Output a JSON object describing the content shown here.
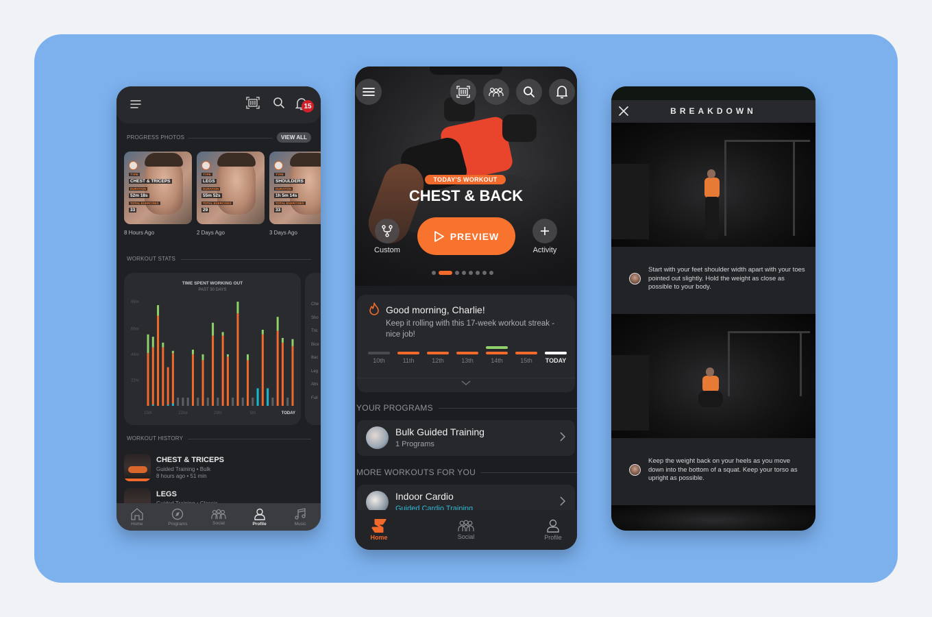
{
  "colors": {
    "page_bg": "#f1f2f6",
    "stage_bg": "#7cb1ee",
    "accent_orange": "#f26a2b",
    "accent_green": "#8fd16a",
    "accent_cyan": "#1bb8d0",
    "rest_gray": "#5e6064",
    "badge_red": "#d0202a"
  },
  "profile_screen": {
    "header": {
      "menu_icon": "hamburger-icon",
      "scan_icon": "barcode-scan-icon",
      "search_icon": "search-icon",
      "bell_icon": "bell-icon",
      "notification_count": "15"
    },
    "progress_photos": {
      "title": "PROGRESS PHOTOS",
      "view_all": "VIEW ALL",
      "photos": [
        {
          "type_label": "TYPE",
          "type": "CHEST & TRICEPS",
          "duration_label": "DURATION",
          "duration": "52m 18s",
          "exercises_label": "TOTAL EXERCISES",
          "exercises": "33",
          "caption": "8 Hours Ago"
        },
        {
          "type_label": "TYPE",
          "type": "LEGS",
          "duration_label": "DURATION",
          "duration": "55m 52s",
          "exercises_label": "TOTAL EXERCISES",
          "exercises": "29",
          "caption": "2 Days Ago"
        },
        {
          "type_label": "TYPE",
          "type": "SHOULDERS",
          "duration_label": "DURATION",
          "duration": "1h 5m 14s",
          "exercises_label": "TOTAL EXERCISES",
          "exercises": "33",
          "caption": "3 Days Ago"
        }
      ]
    },
    "workout_stats": {
      "title": "WORKOUT STATS",
      "muscle_labels": [
        "Che",
        "Sho",
        "Tric",
        "Bice",
        "Bac",
        "Leg",
        "Abs",
        "Full"
      ]
    },
    "workout_history": {
      "title": "WORKOUT HISTORY",
      "items": [
        {
          "title": "CHEST & TRICEPS",
          "line1": "Guided Training • Bulk",
          "line2": "8 hours ago • 51 min"
        },
        {
          "title": "LEGS",
          "line1": "Guided Training • Classic",
          "line2": ""
        }
      ]
    },
    "nav": [
      {
        "label": "Home",
        "icon": "home-icon",
        "active": false
      },
      {
        "label": "Programs",
        "icon": "compass-icon",
        "active": false
      },
      {
        "label": "Social",
        "icon": "group-icon",
        "active": false
      },
      {
        "label": "Profile",
        "icon": "user-icon",
        "active": true
      },
      {
        "label": "Music",
        "icon": "music-note-icon",
        "active": false
      }
    ]
  },
  "chart_data": {
    "type": "bar",
    "title": "TIME SPENT WORKING OUT",
    "subtitle": "PAST 30 DAYS",
    "xlabel": "",
    "ylabel": "",
    "ylim": [
      0,
      89
    ],
    "yticks": [
      "22m",
      "44m",
      "66m",
      "89m"
    ],
    "ytick_values": [
      22,
      44,
      66,
      89
    ],
    "x_tick_labels": [
      {
        "index": 0,
        "label": "15th"
      },
      {
        "index": 7,
        "label": "22nd"
      },
      {
        "index": 14,
        "label": "29th"
      },
      {
        "index": 21,
        "label": "5th"
      },
      {
        "index": 29,
        "label": "TODAY"
      }
    ],
    "stacked": true,
    "series": [
      {
        "name": "strength",
        "color": "#f26a2b",
        "values": [
          45,
          49,
          77,
          50,
          32,
          43,
          0,
          0,
          0,
          44,
          0,
          39,
          0,
          60,
          0,
          60,
          42,
          0,
          79,
          0,
          39,
          0,
          0,
          61,
          0,
          0,
          64,
          54,
          0,
          51
        ]
      },
      {
        "name": "warmup",
        "color": "#8fd16a",
        "values": [
          16,
          9,
          9,
          4,
          0,
          2,
          0,
          0,
          0,
          4,
          0,
          5,
          0,
          11,
          0,
          3,
          2,
          0,
          10,
          0,
          5,
          0,
          0,
          4,
          0,
          0,
          12,
          4,
          0,
          6
        ]
      },
      {
        "name": "cardio",
        "color": "#1bb8d0",
        "values": [
          0,
          1,
          0,
          0,
          1,
          2,
          0,
          0,
          0,
          0,
          0,
          0,
          0,
          0,
          0,
          0,
          0,
          0,
          0,
          0,
          0,
          0,
          15,
          0,
          15,
          0,
          0,
          0,
          0,
          0
        ]
      }
    ],
    "rest_days": [
      6,
      7,
      8,
      10,
      12,
      14,
      17,
      19,
      21,
      25,
      28
    ],
    "grid": false,
    "legend": "none"
  },
  "home_screen": {
    "header_icons": [
      "hamburger-icon",
      "barcode-scan-icon",
      "group-icon",
      "search-icon",
      "bell-icon"
    ],
    "hero": {
      "tag": "TODAY'S WORKOUT",
      "title": "CHEST & BACK",
      "preview_label": "PREVIEW",
      "custom_label": "Custom",
      "activity_label": "Activity",
      "carousel_pages": 8,
      "carousel_active": 1
    },
    "greeting": {
      "title": "Good morning, Charlie!",
      "text": "Keep it rolling with this 17-week workout streak - nice job!",
      "streak": [
        {
          "label": "10th",
          "status": "missed"
        },
        {
          "label": "11th",
          "status": "done"
        },
        {
          "label": "12th",
          "status": "done"
        },
        {
          "label": "13th",
          "status": "done"
        },
        {
          "label": "14th",
          "status": "done-bonus"
        },
        {
          "label": "15th",
          "status": "done"
        },
        {
          "label": "TODAY",
          "status": "today"
        }
      ]
    },
    "your_programs": {
      "title": "YOUR PROGRAMS",
      "items": [
        {
          "title": "Bulk Guided Training",
          "subtitle": "1 Programs"
        }
      ]
    },
    "more_workouts": {
      "title": "MORE WORKOUTS FOR YOU",
      "items": [
        {
          "title": "Indoor Cardio",
          "subtitle": "Guided Cardio Training"
        }
      ]
    },
    "nav": [
      {
        "label": "Home",
        "icon": "brand-logo-icon",
        "active": true
      },
      {
        "label": "Social",
        "icon": "group-icon",
        "active": false
      },
      {
        "label": "Profile",
        "icon": "user-icon",
        "active": false
      }
    ]
  },
  "breakdown_screen": {
    "title": "BREAKDOWN",
    "close_icon": "close-icon",
    "steps": [
      {
        "text": "Start with your feet shoulder width apart with your toes pointed out slightly. Hold the weight as close as possible to your body."
      },
      {
        "text": "Keep the weight back on your heels as you move down into the bottom of a squat. Keep your torso as upright as possible."
      }
    ]
  }
}
